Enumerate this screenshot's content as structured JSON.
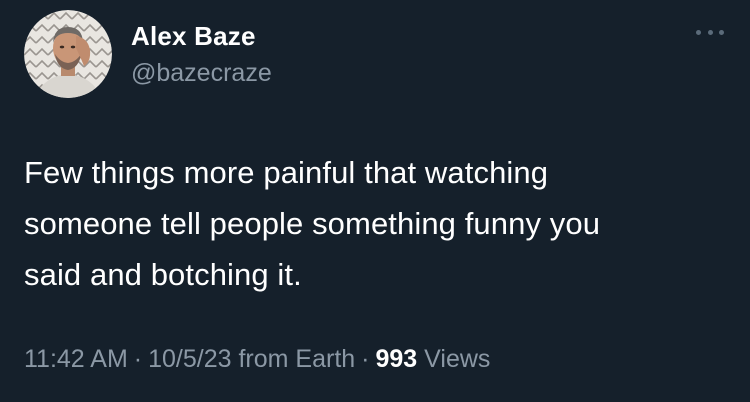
{
  "author": {
    "name": "Alex Baze",
    "handle": "@bazecraze",
    "avatar": "avatar"
  },
  "more_menu": {
    "icon": "more-horizontal-icon"
  },
  "tweet": {
    "lines": [
      "Few things more painful that watching",
      "someone tell people something funny you",
      "said and botching it."
    ]
  },
  "meta": {
    "time": "11:42 AM",
    "separator": "·",
    "date_source": "10/5/23 from Earth",
    "views_count": "993",
    "views_label": "Views"
  },
  "colors": {
    "background": "#15202b",
    "primary_text": "#ffffff",
    "secondary_text": "#8b98a5"
  }
}
